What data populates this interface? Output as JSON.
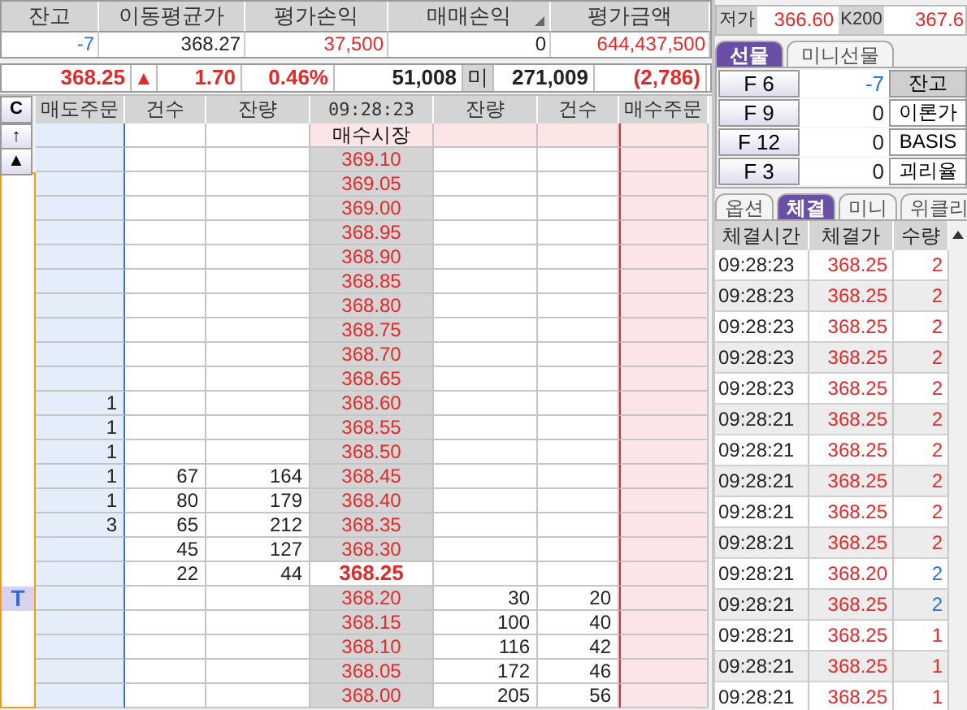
{
  "position": {
    "columns": [
      {
        "label": "잔고",
        "sorted": false
      },
      {
        "label": "이동평균가",
        "sorted": false
      },
      {
        "label": "평가손익",
        "sorted": false
      },
      {
        "label": "매매손익",
        "sorted": true
      },
      {
        "label": "평가금액",
        "sorted": false
      }
    ],
    "values": [
      {
        "text": "-7",
        "color": "#2b6fd8"
      },
      {
        "text": "368.27",
        "color": "#222222"
      },
      {
        "text": "37,500",
        "color": "#e02b2b"
      },
      {
        "text": "0",
        "color": "#222222"
      },
      {
        "text": "644,437,500",
        "color": "#e02b2b"
      }
    ]
  },
  "quote": [
    {
      "text": "368.25",
      "color": "#e02b2b",
      "kind": "value"
    },
    {
      "text": "▲",
      "color": "#e02b2b",
      "kind": "arrow"
    },
    {
      "text": "1.70",
      "color": "#e02b2b",
      "kind": "value"
    },
    {
      "text": "0.46%",
      "color": "#e02b2b",
      "kind": "value"
    },
    {
      "text": "51,008",
      "color": "#222222",
      "kind": "value"
    },
    {
      "text": "미",
      "color": "#222222",
      "kind": "label"
    },
    {
      "text": "271,009",
      "color": "#222222",
      "kind": "value"
    },
    {
      "text": "(2,786)",
      "color": "#e02b2b",
      "kind": "value"
    }
  ],
  "orderbook": {
    "side_buttons": [
      "C",
      "↑",
      "▲"
    ],
    "marker": "T",
    "columns": [
      "매도주문",
      "건수",
      "잔량",
      "09:28:23",
      "잔량",
      "건수",
      "매수주문"
    ],
    "rows": [
      {
        "kind": "market",
        "price": "매수시장",
        "marked": false
      },
      {
        "kind": "price",
        "price": "369.10",
        "marked": false
      },
      {
        "kind": "price",
        "price": "369.05",
        "marked": false
      },
      {
        "kind": "price",
        "price": "369.00",
        "marked": false
      },
      {
        "kind": "price",
        "price": "368.95",
        "marked": false
      },
      {
        "kind": "price",
        "price": "368.90",
        "marked": false
      },
      {
        "kind": "price",
        "price": "368.85",
        "marked": false
      },
      {
        "kind": "price",
        "price": "368.80",
        "marked": false
      },
      {
        "kind": "price",
        "price": "368.75",
        "marked": false
      },
      {
        "kind": "price",
        "price": "368.70",
        "marked": false
      },
      {
        "kind": "price",
        "price": "368.65",
        "marked": false
      },
      {
        "kind": "price",
        "price": "368.60",
        "sell_order": "1",
        "marked": false
      },
      {
        "kind": "price",
        "price": "368.55",
        "sell_order": "1",
        "marked": false
      },
      {
        "kind": "price",
        "price": "368.50",
        "sell_order": "1",
        "marked": false
      },
      {
        "kind": "price",
        "price": "368.45",
        "sell_order": "1",
        "sell_count": "67",
        "sell_qty": "164",
        "marked": false
      },
      {
        "kind": "price",
        "price": "368.40",
        "sell_order": "1",
        "sell_count": "80",
        "sell_qty": "179",
        "marked": false
      },
      {
        "kind": "price",
        "price": "368.35",
        "sell_order": "3",
        "sell_count": "65",
        "sell_qty": "212",
        "marked": false
      },
      {
        "kind": "price",
        "price": "368.30",
        "sell_count": "45",
        "sell_qty": "127",
        "marked": false
      },
      {
        "kind": "current",
        "price": "368.25",
        "sell_count": "22",
        "sell_qty": "44",
        "marked": false
      },
      {
        "kind": "price",
        "price": "368.20",
        "buy_qty": "30",
        "buy_count": "20",
        "marked": true
      },
      {
        "kind": "price",
        "price": "368.15",
        "buy_qty": "100",
        "buy_count": "40",
        "marked": false
      },
      {
        "kind": "price",
        "price": "368.10",
        "buy_qty": "116",
        "buy_count": "42",
        "marked": false
      },
      {
        "kind": "price",
        "price": "368.05",
        "buy_qty": "172",
        "buy_count": "46",
        "marked": false
      },
      {
        "kind": "price",
        "price": "368.00",
        "buy_qty": "205",
        "buy_count": "56",
        "marked": false
      }
    ]
  },
  "summary": [
    {
      "text": "저가",
      "kind": "label"
    },
    {
      "text": "366.60",
      "kind": "value"
    },
    {
      "text": "K200",
      "kind": "label"
    },
    {
      "text": "367.6",
      "kind": "value"
    }
  ],
  "market_tabs": [
    {
      "label": "선물",
      "selected": true
    },
    {
      "label": "미니선물",
      "selected": false
    }
  ],
  "futures": [
    {
      "code": "F 6",
      "qty": "-7",
      "color": "#2b6fd8",
      "action": "잔고",
      "pressed": true
    },
    {
      "code": "F 9",
      "qty": "0",
      "color": "#222222",
      "action": "이론가",
      "pressed": false
    },
    {
      "code": "F 12",
      "qty": "0",
      "color": "#222222",
      "action": "BASIS",
      "pressed": false
    },
    {
      "code": "F 3",
      "qty": "0",
      "color": "#222222",
      "action": "괴리율",
      "pressed": false
    }
  ],
  "trade_tabs": [
    {
      "label": "옵션",
      "selected": false
    },
    {
      "label": "체결",
      "selected": true
    },
    {
      "label": "미니",
      "selected": false
    },
    {
      "label": "위클리",
      "selected": false
    }
  ],
  "trades": {
    "columns": [
      "체결시간",
      "체결가",
      "수량"
    ],
    "rows": [
      {
        "time": "09:28:23",
        "price": "368.25",
        "qty": "2",
        "color": "#e02b2b"
      },
      {
        "time": "09:28:23",
        "price": "368.25",
        "qty": "2",
        "color": "#e02b2b"
      },
      {
        "time": "09:28:23",
        "price": "368.25",
        "qty": "2",
        "color": "#e02b2b"
      },
      {
        "time": "09:28:23",
        "price": "368.25",
        "qty": "2",
        "color": "#e02b2b"
      },
      {
        "time": "09:28:23",
        "price": "368.25",
        "qty": "2",
        "color": "#e02b2b"
      },
      {
        "time": "09:28:21",
        "price": "368.25",
        "qty": "2",
        "color": "#e02b2b"
      },
      {
        "time": "09:28:21",
        "price": "368.25",
        "qty": "2",
        "color": "#e02b2b"
      },
      {
        "time": "09:28:21",
        "price": "368.25",
        "qty": "2",
        "color": "#e02b2b"
      },
      {
        "time": "09:28:21",
        "price": "368.25",
        "qty": "2",
        "color": "#e02b2b"
      },
      {
        "time": "09:28:21",
        "price": "368.25",
        "qty": "2",
        "color": "#e02b2b"
      },
      {
        "time": "09:28:21",
        "price": "368.20",
        "qty": "2",
        "color": "#2b6fd8"
      },
      {
        "time": "09:28:21",
        "price": "368.25",
        "qty": "2",
        "color": "#2b6fd8"
      },
      {
        "time": "09:28:21",
        "price": "368.25",
        "qty": "1",
        "color": "#e02b2b"
      },
      {
        "time": "09:28:21",
        "price": "368.25",
        "qty": "1",
        "color": "#e02b2b"
      },
      {
        "time": "09:28:21",
        "price": "368.25",
        "qty": "1",
        "color": "#e02b2b"
      }
    ]
  }
}
